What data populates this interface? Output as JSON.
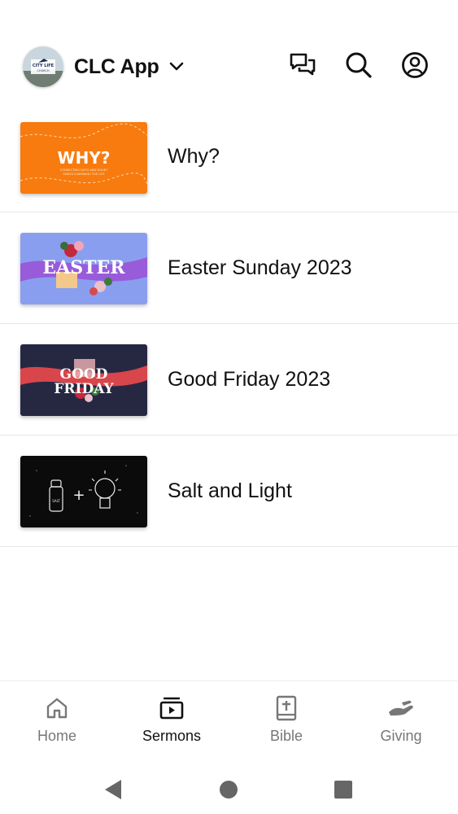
{
  "header": {
    "logo_name": "city-life-church-logo",
    "logo_text_top": "CITY LIFE",
    "logo_text_bottom": "CHURCH",
    "app_title": "CLC App",
    "icons": [
      "chevron-down-icon",
      "chat-icon",
      "search-icon",
      "account-icon"
    ]
  },
  "sermons": [
    {
      "title": "Why?",
      "thumb": {
        "headline": "WHY?",
        "caption_line1": "CONNECTING FAITH AND DOUBT",
        "caption_line2": "SERIES EXAMINING THE LIFE",
        "bg": "#f77b0f"
      }
    },
    {
      "title": "Easter Sunday 2023",
      "thumb": {
        "headline": "EASTER",
        "bg": "#8a9ef0"
      }
    },
    {
      "title": "Good Friday 2023",
      "thumb": {
        "headline_line1": "GOOD",
        "headline_line2": "FRIDAY",
        "bg": "#262842"
      }
    },
    {
      "title": "Salt and Light",
      "thumb": {
        "plus": "+",
        "shaker_label": "SALT",
        "bg": "#0b0b0b"
      }
    }
  ],
  "tabs": [
    {
      "label": "Home",
      "icon": "home-icon",
      "active": false
    },
    {
      "label": "Sermons",
      "icon": "sermons-icon",
      "active": true
    },
    {
      "label": "Bible",
      "icon": "bible-icon",
      "active": false
    },
    {
      "label": "Giving",
      "icon": "giving-hand-icon",
      "active": false
    }
  ],
  "system_nav": [
    "back-icon",
    "home-circle-icon",
    "recents-icon"
  ],
  "colors": {
    "text": "#111111",
    "inactive": "#777777",
    "divider": "#e6e6e6"
  }
}
